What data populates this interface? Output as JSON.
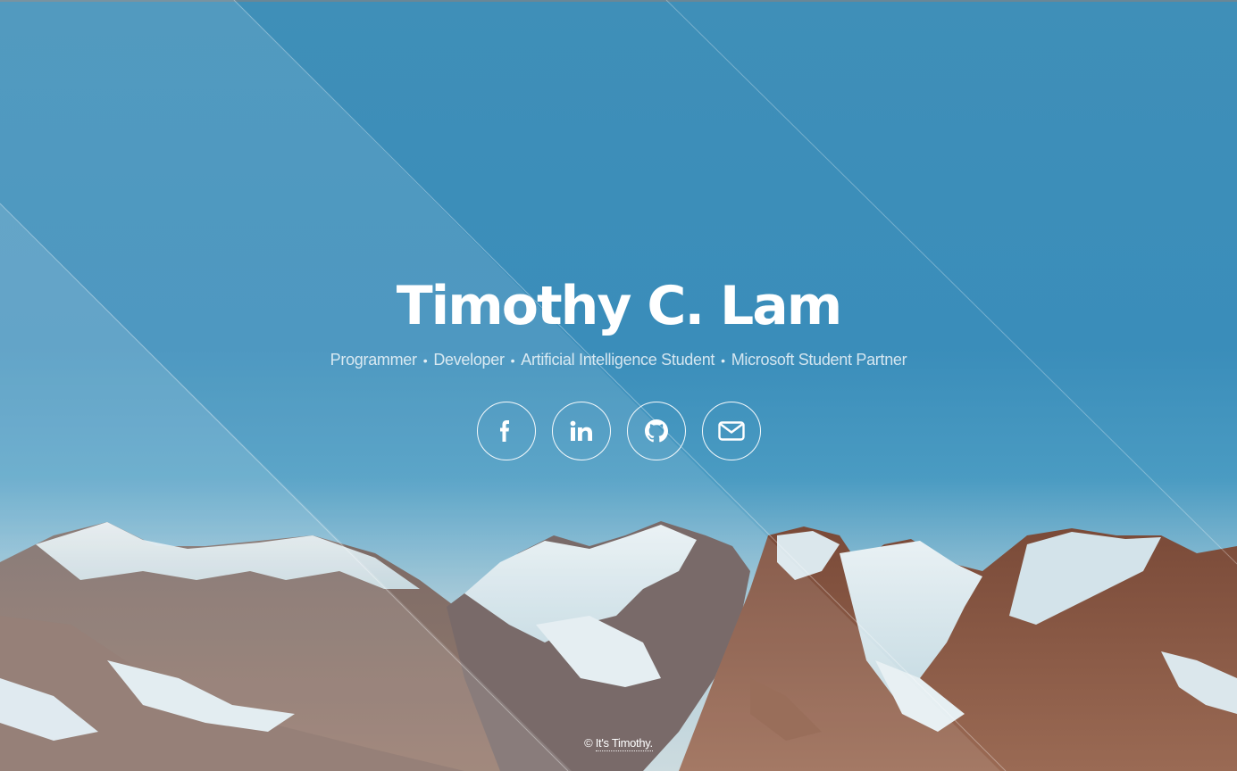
{
  "header": {
    "title": "Timothy C. Lam",
    "roles": [
      "Programmer",
      "Developer",
      "Artificial Intelligence Student",
      "Microsoft Student Partner"
    ],
    "separator": "•"
  },
  "social": [
    {
      "name": "facebook",
      "icon": "facebook-icon"
    },
    {
      "name": "linkedin",
      "icon": "linkedin-icon"
    },
    {
      "name": "github",
      "icon": "github-icon"
    },
    {
      "name": "email",
      "icon": "envelope-icon"
    }
  ],
  "footer": {
    "copyright_symbol": "©",
    "link_text": "It's Timothy."
  },
  "colors": {
    "sky": "#3a8dba",
    "text": "#ffffff"
  }
}
